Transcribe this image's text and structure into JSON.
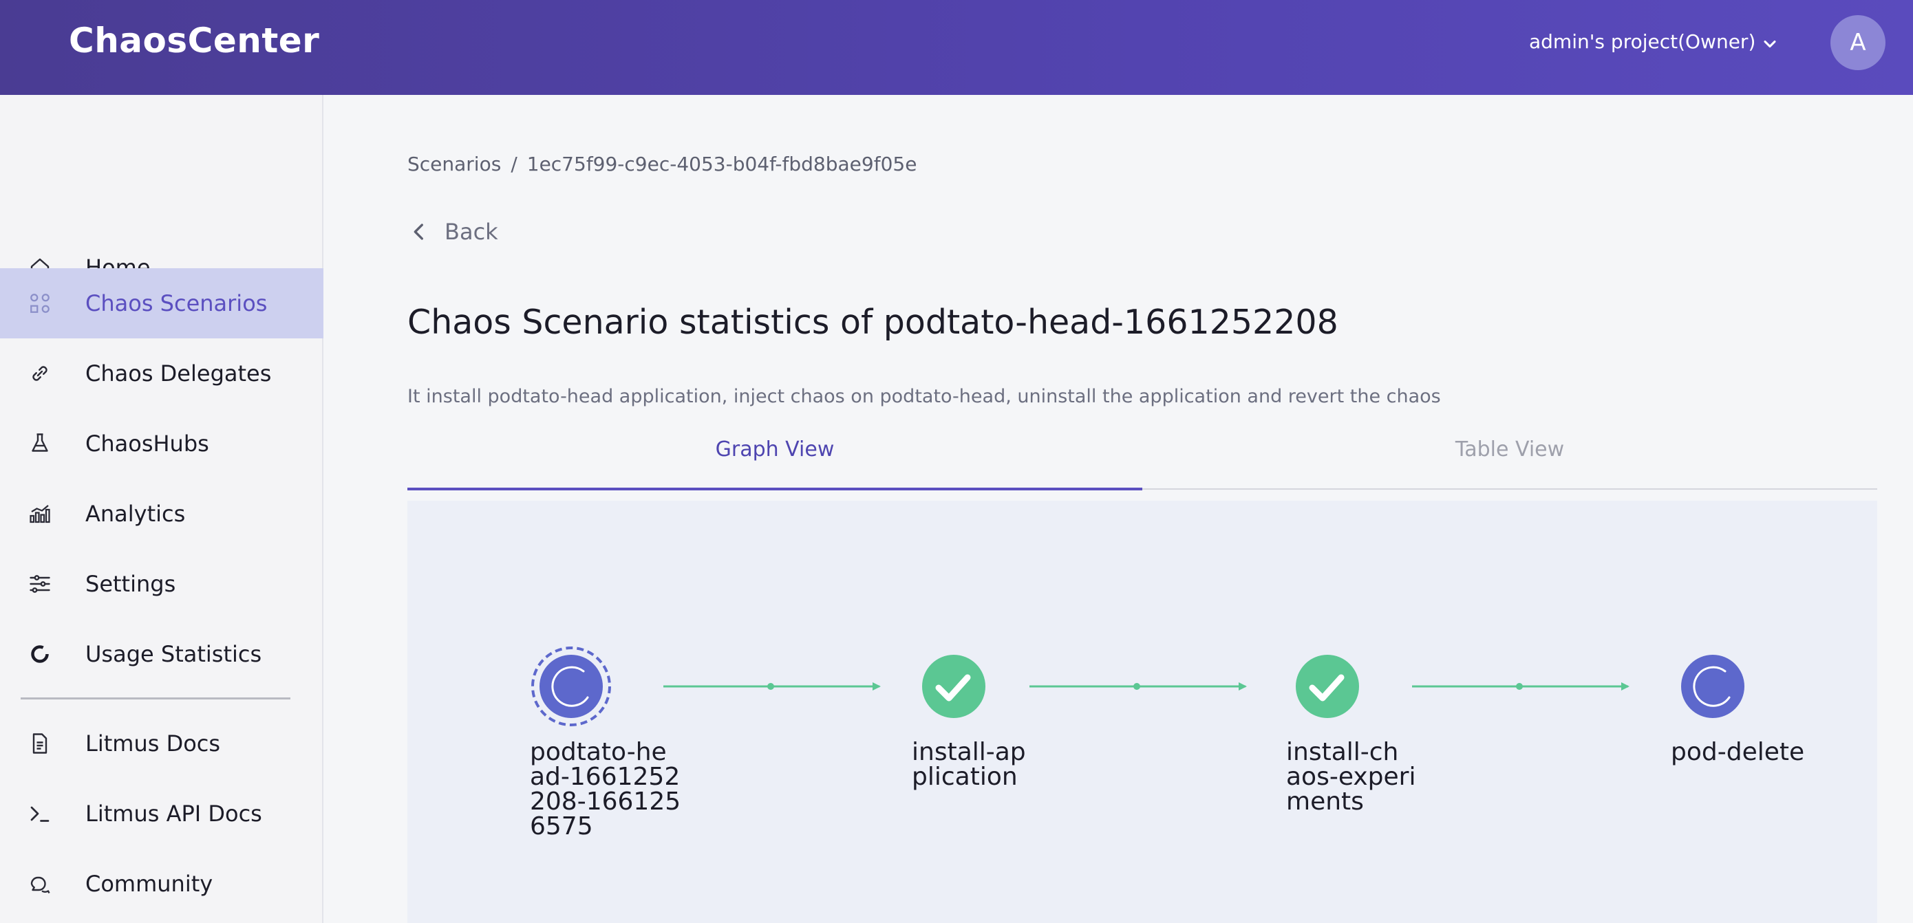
{
  "header": {
    "brand": "ChaosCenter",
    "project": "admin's project(Owner)",
    "avatar_initial": "A"
  },
  "sidebar": {
    "items": [
      {
        "label": "Home",
        "icon": "home-icon"
      },
      {
        "label": "Chaos Scenarios",
        "icon": "scenarios-icon",
        "active": true
      },
      {
        "label": "Chaos Delegates",
        "icon": "link-icon"
      },
      {
        "label": "ChaosHubs",
        "icon": "flask-icon"
      },
      {
        "label": "Analytics",
        "icon": "analytics-icon"
      },
      {
        "label": "Settings",
        "icon": "sliders-icon"
      },
      {
        "label": "Usage Statistics",
        "icon": "ring-icon"
      },
      {
        "label": "Litmus Docs",
        "icon": "document-icon"
      },
      {
        "label": "Litmus API Docs",
        "icon": "terminal-icon"
      },
      {
        "label": "Community",
        "icon": "chat-icon"
      }
    ]
  },
  "breadcrumb": {
    "root": "Scenarios",
    "separator": "/",
    "current": "1ec75f99-c9ec-4053-b04f-fbd8bae9f05e"
  },
  "back_label": "Back",
  "page": {
    "title": "Chaos Scenario statistics of podtato-head-1661252208",
    "description": "It install podtato-head application, inject chaos on podtato-head, uninstall the application and revert the chaos"
  },
  "tabs": {
    "graph": "Graph View",
    "table": "Table View"
  },
  "graph": {
    "nodes": [
      {
        "label_lines": [
          "podtato-he",
          "ad-1661252",
          "208-166125",
          "6575"
        ],
        "status": "running-root"
      },
      {
        "label_lines": [
          "install-ap",
          "plication"
        ],
        "status": "succeeded"
      },
      {
        "label_lines": [
          "install-ch",
          "aos-experi",
          "ments"
        ],
        "status": "succeeded"
      },
      {
        "label_lines": [
          "pod-delete"
        ],
        "status": "running"
      }
    ]
  },
  "colors": {
    "accent": "#5b4fc0",
    "success": "#5bc793",
    "running": "#5d68cc",
    "edge": "#5bc793"
  }
}
